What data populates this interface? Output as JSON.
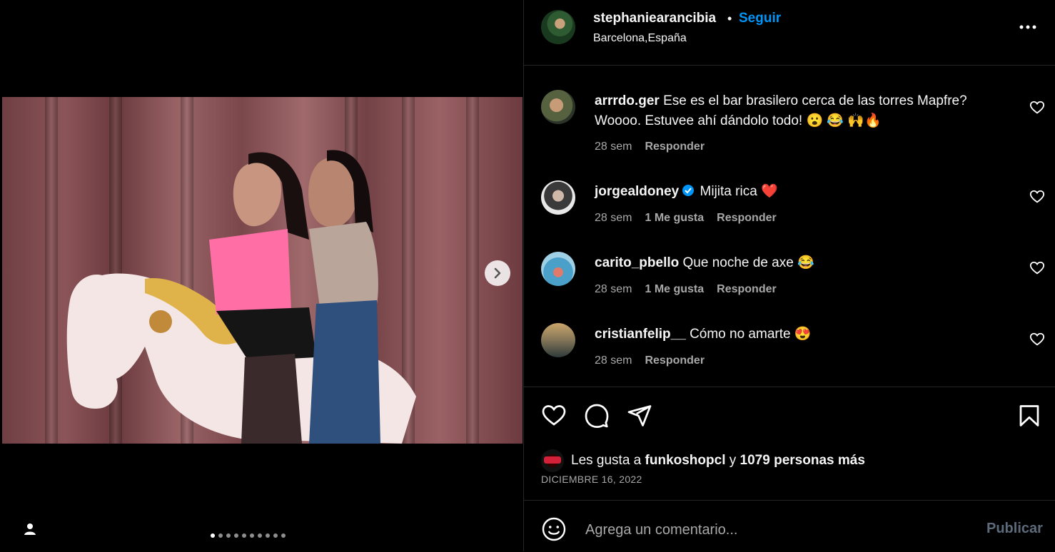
{
  "post": {
    "image_count": 10,
    "active_index": 0
  },
  "header": {
    "username": "stephaniearancibia",
    "separator": "•",
    "follow_label": "Seguir",
    "location": "Barcelona,España"
  },
  "comments": [
    {
      "username": "arrrdo.ger",
      "verified": false,
      "text": "Ese es el bar brasilero cerca de las torres Mapfre? Woooo. Estuvee ahí dándolo todo! 😮 😂 🙌🔥",
      "time": "28 sem",
      "likes_label": "",
      "reply_label": "Responder"
    },
    {
      "username": "jorgealdoney",
      "verified": true,
      "text": "Mijita rica ❤️",
      "time": "28 sem",
      "likes_label": "1 Me gusta",
      "reply_label": "Responder"
    },
    {
      "username": "carito_pbello",
      "verified": false,
      "text": "Que noche de axe 😂",
      "time": "28 sem",
      "likes_label": "1 Me gusta",
      "reply_label": "Responder"
    },
    {
      "username": "cristianfelip__",
      "verified": false,
      "text": "Cómo no amarte 😍",
      "time": "28 sem",
      "likes_label": "",
      "reply_label": "Responder"
    }
  ],
  "likes": {
    "prefix": "Les gusta a",
    "user": "funkoshopcl",
    "connector": "y",
    "others": "1079 personas más"
  },
  "date": "DICIEMBRE 16, 2022",
  "composer": {
    "placeholder": "Agrega un comentario...",
    "publish_label": "Publicar"
  },
  "icons": {
    "next": "chevron-right-icon",
    "user_tags": "person-icon",
    "more": "more-horizontal-icon",
    "like": "heart-icon",
    "comment": "comment-icon",
    "share": "paper-plane-icon",
    "save": "bookmark-icon",
    "emoji": "smiley-icon"
  },
  "colors": {
    "accent": "#0095f6",
    "secondary_text": "#a8a8a8",
    "divider": "#262626"
  }
}
